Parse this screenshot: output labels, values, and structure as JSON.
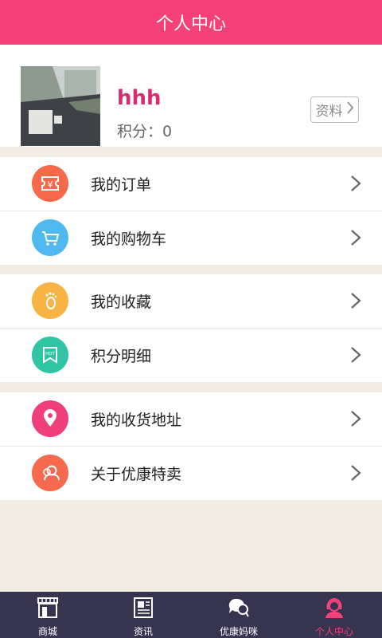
{
  "header": {
    "title": "个人中心"
  },
  "profile": {
    "username": "hhh",
    "points_text": "积分：0",
    "detail_label": "资料"
  },
  "colors": {
    "brand": "#f5407a",
    "tabbar": "#36344f"
  },
  "menu_groups": [
    [
      {
        "label": "我的订单",
        "icon": "ticket-icon",
        "color": "#f8684a"
      },
      {
        "label": "我的购物车",
        "icon": "cart-icon",
        "color": "#4fb8ef"
      }
    ],
    [
      {
        "label": "我的收藏",
        "icon": "footprint-icon",
        "color": "#f7b344"
      },
      {
        "label": "积分明细",
        "icon": "hot-tag-icon",
        "color": "#2fc4a4"
      }
    ],
    [
      {
        "label": "我的收货地址",
        "icon": "location-pin-icon",
        "color": "#ef3e7b"
      },
      {
        "label": "关于优康特卖",
        "icon": "people-icon",
        "color": "#f76a4e"
      }
    ]
  ],
  "tabs": [
    {
      "label": "商城",
      "icon": "store-icon"
    },
    {
      "label": "资讯",
      "icon": "news-icon"
    },
    {
      "label": "优康妈咪",
      "icon": "chat-icon"
    },
    {
      "label": "个人中心",
      "icon": "user-icon",
      "active": true
    }
  ]
}
